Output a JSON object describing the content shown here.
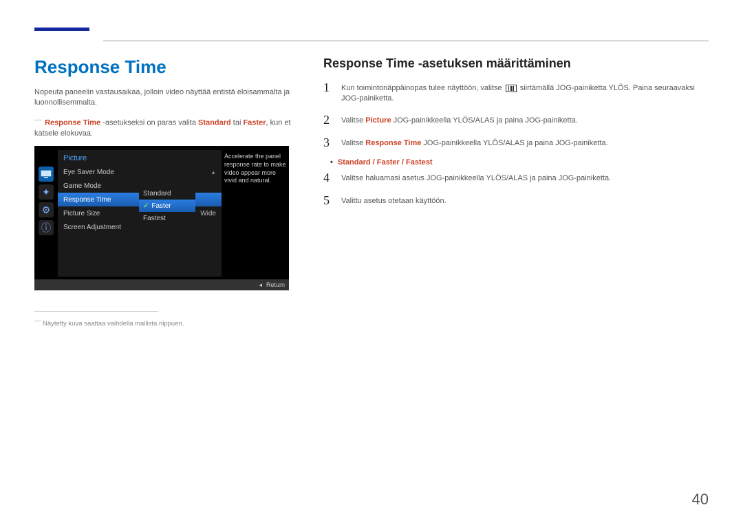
{
  "pageNumber": "40",
  "left": {
    "title": "Response Time",
    "intro": "Nopeuta paneelin vastausaikaa, jolloin video näyttää entistä eloisammalta ja luonnollisemmalta.",
    "note_prefix_hl": "Response Time",
    "note_mid1": " -asetukseksi on paras valita ",
    "note_hl2": "Standard",
    "note_mid2": " tai ",
    "note_hl3": "Faster",
    "note_end": ", kun et katsele elokuvaa.",
    "footnote": "Näytetty kuva saattaa vaihdella mallista riippuen."
  },
  "osd": {
    "title": "Picture",
    "items": {
      "eyeSaver": "Eye Saver Mode",
      "gameMode": "Game Mode",
      "responseTime": "Response Time",
      "pictureSize": "Picture Size",
      "screenAdj": "Screen Adjustment",
      "wide": "Wide"
    },
    "sub": {
      "standard": "Standard",
      "faster": "Faster",
      "fastest": "Fastest"
    },
    "desc": "Accelerate the panel response rate to make video appear more vivid and natural.",
    "return": "Return"
  },
  "right": {
    "title": "Response Time -asetuksen määrittäminen",
    "step1_a": "Kun toimintonäppäinopas tulee näyttöön, valitse ",
    "step1_b": " siirtämällä JOG-painiketta YLÖS. Paina seuraavaksi JOG-painiketta.",
    "step2_a": "Valitse ",
    "step2_hl": "Picture",
    "step2_b": " JOG-painikkeella YLÖS/ALAS ja paina JOG-painiketta.",
    "step3_a": "Valitse ",
    "step3_hl": "Response Time",
    "step3_b": " JOG-painikkeella YLÖS/ALAS ja paina JOG-painiketta.",
    "options": {
      "o1": "Standard",
      "sep": " / ",
      "o2": "Faster",
      "o3": "Fastest"
    },
    "step4": "Valitse haluamasi asetus JOG-painikkeella YLÖS/ALAS ja paina JOG-painiketta.",
    "step5": "Valittu asetus otetaan käyttöön.",
    "nums": {
      "n1": "1",
      "n2": "2",
      "n3": "3",
      "n4": "4",
      "n5": "5"
    }
  }
}
